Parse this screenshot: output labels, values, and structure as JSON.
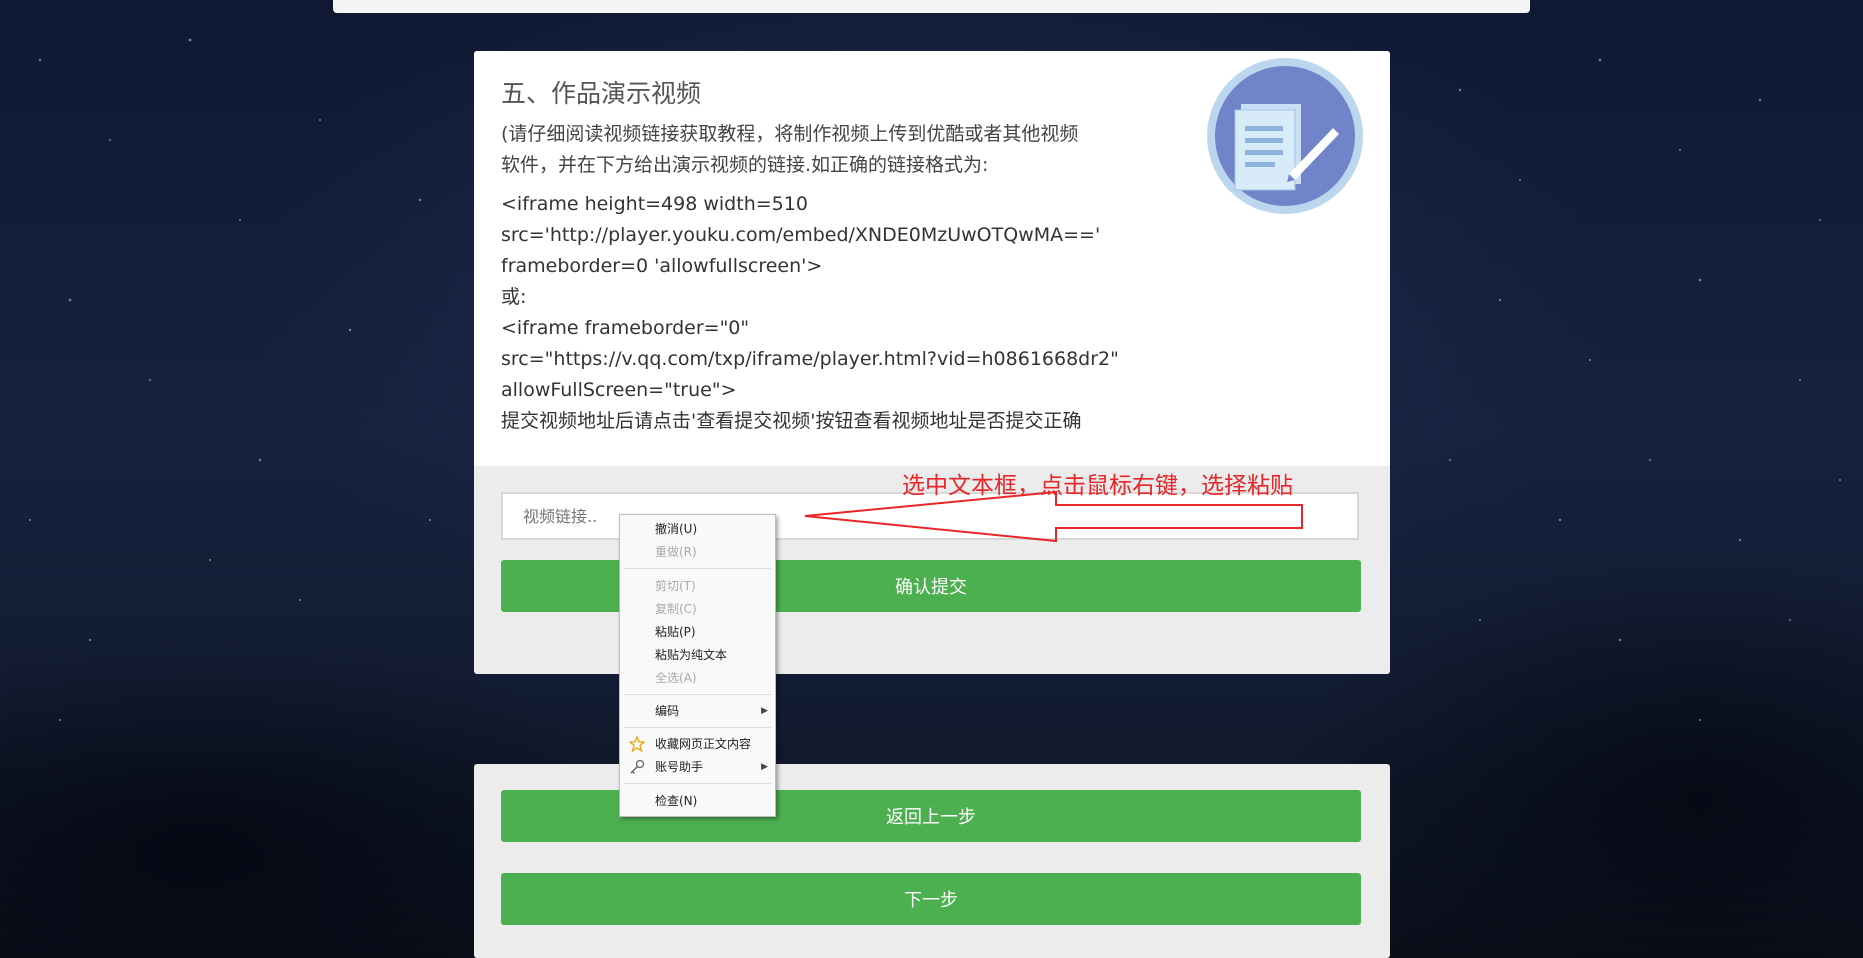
{
  "section": {
    "title": "五、作品演示视频",
    "intro_line1": "(请仔细阅读视频链接获取教程，将制作视频上传到优酷或者其他视频",
    "intro_line2": "软件，并在下方给出演示视频的链接.如正确的链接格式为:",
    "code_lines": [
      "<iframe height=498 width=510",
      "src='http://player.youku.com/embed/XNDE0MzUwOTQwMA=='",
      "frameborder=0 'allowfullscreen'>",
      "或:",
      "<iframe frameborder=\"0\"",
      "src=\"https://v.qq.com/txp/iframe/player.html?vid=h0861668dr2\"",
      "allowFullScreen=\"true\">",
      "提交视频地址后请点击'查看提交视频'按钮查看视频地址是否提交正确"
    ]
  },
  "form": {
    "video_link_placeholder": "视频链接..",
    "confirm_label": "确认提交"
  },
  "annotation": {
    "text": "选中文本框，点击鼠标右键，选择粘贴",
    "color": "#e8262a"
  },
  "context_menu": {
    "items": [
      {
        "label": "撤消(U)",
        "enabled": true
      },
      {
        "label": "重做(R)",
        "enabled": false
      },
      {
        "label": "剪切(T)",
        "enabled": false
      },
      {
        "label": "复制(C)",
        "enabled": false
      },
      {
        "label": "粘贴(P)",
        "enabled": true
      },
      {
        "label": "粘贴为纯文本",
        "enabled": true
      },
      {
        "label": "全选(A)",
        "enabled": false
      },
      {
        "label": "编码",
        "enabled": true,
        "submenu": true
      },
      {
        "label": "收藏网页正文内容",
        "enabled": true,
        "icon": "star-icon"
      },
      {
        "label": "账号助手",
        "enabled": true,
        "submenu": true,
        "icon": "key-icon"
      },
      {
        "label": "检查(N)",
        "enabled": true
      }
    ]
  },
  "nav": {
    "back_label": "返回上一步",
    "next_label": "下一步"
  },
  "colors": {
    "button_green": "#4caf50",
    "annotation_red": "#e8262a"
  }
}
